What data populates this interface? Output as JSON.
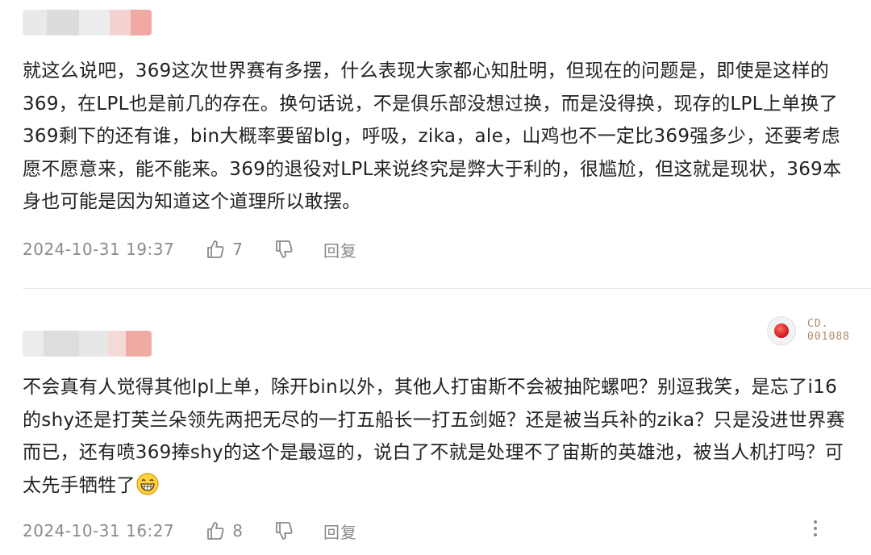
{
  "comments": [
    {
      "text": "就这么说吧，369这次世界赛有多摆，什么表现大家都心知肚明，但现在的问题是，即使是这样的369，在LPL也是前几的存在。换句话说，不是俱乐部没想过换，而是没得换，现存的LPL上单换了369剩下的还有谁，bin大概率要留blg，呼吸，zika，ale，山鸡也不一定比369强多少，还要考虑愿不愿意来，能不能来。369的退役对LPL来说终究是弊大于利的，很尴尬，但这就是现状，369本身也可能是因为知道这个道理所以敢摆。",
      "date": "2024-10-31 19:37",
      "likes": "7",
      "reply_label": "回复"
    },
    {
      "text": "不会真有人觉得其他lpl上单，除开bin以外，其他人打宙斯不会被抽陀螺吧？别逗我笑，是忘了i16的shy还是打芙兰朵领先两把无尽的一打五船长一打五剑姬？还是被当兵补的zika？只是没进世界赛而已，还有喷369捧shy的这个是最逗的，说白了不就是处理不了宙斯的英雄池，被当人机打吗？可太先手牺牲了",
      "date": "2024-10-31 16:27",
      "likes": "8",
      "reply_label": "回复",
      "badge_line1": "CD.",
      "badge_line2": "001088"
    }
  ],
  "icons": {
    "like": "thumbs-up-icon",
    "dislike": "thumbs-down-icon",
    "more": "more-vertical-icon",
    "emoji": "grinning-emoji-icon"
  },
  "colors": {
    "meta_text": "#8a8a8a",
    "body_text": "#222222",
    "badge_red": "#c8141a"
  }
}
